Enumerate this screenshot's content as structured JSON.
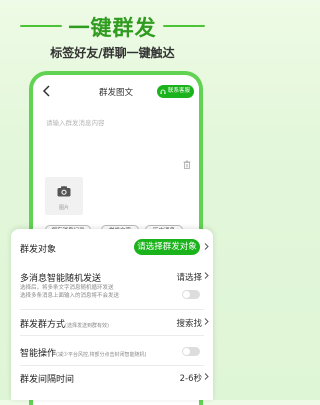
{
  "hero": {
    "title": "一键群发",
    "subtitle": "标签好友/群聊一键触达"
  },
  "phone": {
    "back_icon": "back-arrow-icon",
    "title": "群发图文",
    "service_button": "联系客服",
    "message_placeholder": "请输入群发消息内容",
    "image_label": "图片",
    "chips": [
      "保存消息记录",
      "常发文字",
      "历史消息"
    ]
  },
  "settings": {
    "target": {
      "title": "群发对象",
      "button": "请选择群发对象"
    },
    "multi": {
      "title": "多消息智能随机发送",
      "value": "请选择",
      "desc_line1": "选择后，将多条文字消息随机循环发送",
      "desc_line2": "选择多条消息上面输入的消息将不会发送",
      "toggle_on": false
    },
    "method": {
      "title": "群发群方式",
      "note": "(选择发送到群有效)",
      "value": "搜索找"
    },
    "smart": {
      "title": "智能操作",
      "note": "(减少平台风控,将部分点击封闭智能随机)",
      "toggle_on": false
    },
    "interval": {
      "title": "群发间隔时间",
      "value": "2-6秒"
    }
  },
  "colors": {
    "brand_green": "#1bb31b",
    "title_green": "#2f9b1f",
    "frame_green": "#62d253"
  }
}
